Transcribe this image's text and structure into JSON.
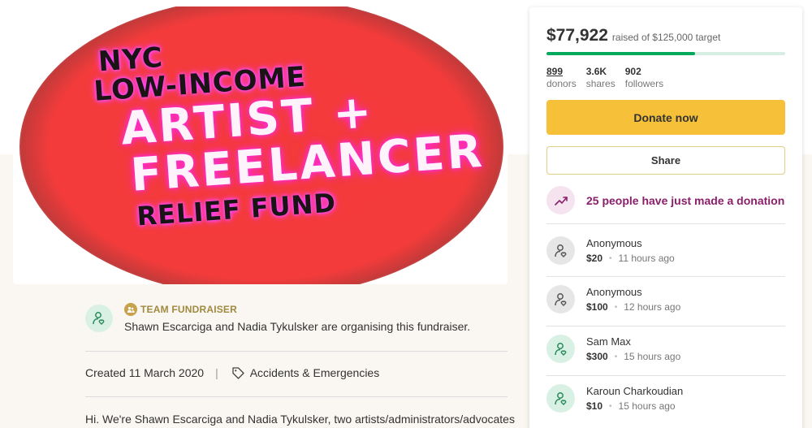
{
  "hero": {
    "lines": [
      "NYC",
      "LOW-INCOME",
      "ARTIST +",
      "FREELANCER",
      "RELIEF FUND"
    ]
  },
  "organiser": {
    "team_label": "TEAM FUNDRAISER",
    "text": "Shawn Escarciga and Nadia Tykulsker are organising this fundraiser."
  },
  "meta": {
    "created": "Created 11 March 2020",
    "separator": "|",
    "category": "Accidents & Emergencies"
  },
  "story": {
    "excerpt": "Hi. We're Shawn Escarciga and Nadia Tykulsker, two artists/administrators/advocates"
  },
  "panel": {
    "raised_amount": "$77,922",
    "raised_target": "raised of $125,000 target",
    "progress_fraction": 0.623,
    "stats": [
      {
        "value": "899",
        "label": "donors"
      },
      {
        "value": "3.6K",
        "label": "shares"
      },
      {
        "value": "902",
        "label": "followers"
      }
    ],
    "donate_label": "Donate now",
    "share_label": "Share",
    "trend_text": "25 people have just made a donation",
    "donations": [
      {
        "name": "Anonymous",
        "amount": "$20",
        "time": "11 hours ago",
        "avatar": "grey"
      },
      {
        "name": "Anonymous",
        "amount": "$100",
        "time": "12 hours ago",
        "avatar": "grey"
      },
      {
        "name": "Sam Max",
        "amount": "$300",
        "time": "15 hours ago",
        "avatar": "green"
      },
      {
        "name": "Karoun Charkoudian",
        "amount": "$10",
        "time": "15 hours ago",
        "avatar": "green"
      }
    ]
  },
  "colors": {
    "accent_green": "#02a95c",
    "donate_yellow": "#f6c139",
    "trend_purple": "#8a1f6a",
    "team_gold": "#a08a3f"
  }
}
